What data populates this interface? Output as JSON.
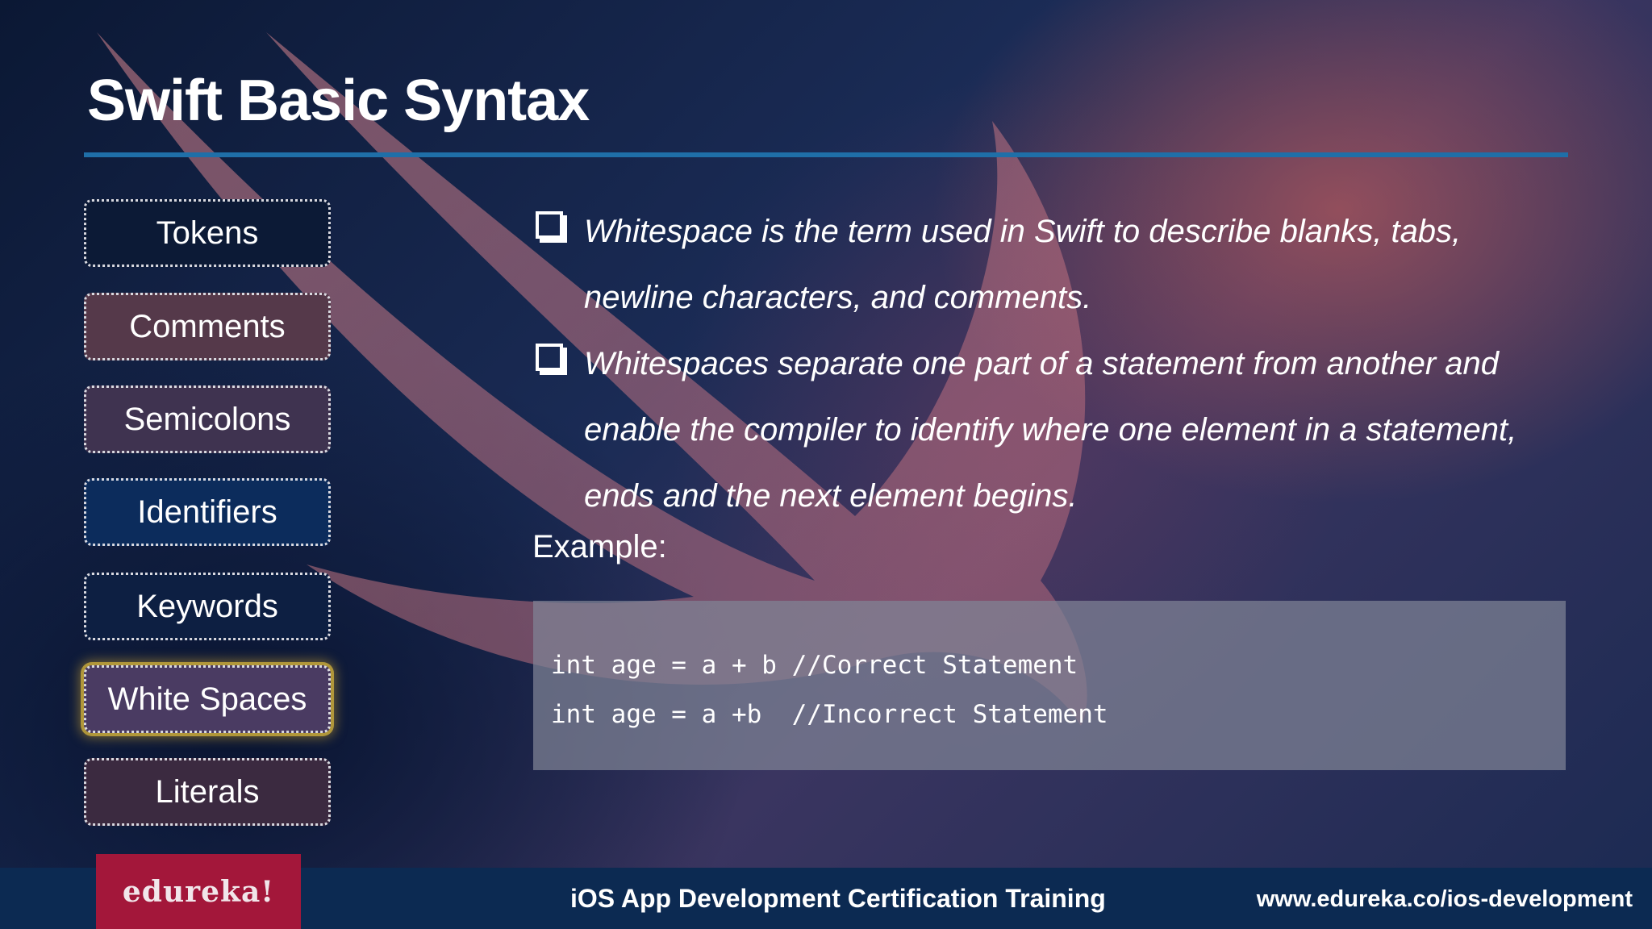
{
  "slide": {
    "title": "Swift Basic Syntax"
  },
  "sidebar": {
    "items": [
      {
        "label": "Tokens",
        "bg": "#0c1a36",
        "active": false
      },
      {
        "label": "Comments",
        "bg": "#55394a",
        "active": false
      },
      {
        "label": "Semicolons",
        "bg": "#3f3350",
        "active": false
      },
      {
        "label": "Identifiers",
        "bg": "#0c2c5c",
        "active": false
      },
      {
        "label": "Keywords",
        "bg": "#0d1f42",
        "active": false
      },
      {
        "label": "White Spaces",
        "bg": "#4a3b62",
        "active": true
      },
      {
        "label": "Literals",
        "bg": "#3b2a40",
        "active": false
      }
    ]
  },
  "content": {
    "bullets": [
      {
        "icon": "checkbox-icon",
        "lines": [
          "Whitespace is the term used in Swift to describe blanks, tabs,",
          "newline characters, and comments."
        ]
      },
      {
        "icon": "checkbox-icon",
        "lines": [
          "Whitespaces separate one part of a statement from another and",
          "enable the compiler to identify where one element in a statement,",
          "ends and the next element begins."
        ]
      }
    ],
    "example_label": "Example:",
    "code": [
      "int age = a + b //Correct Statement",
      "int age = a +b  //Incorrect Statement"
    ]
  },
  "footer": {
    "logo_text": "edureka!",
    "course_title": "iOS App Development Certification Training",
    "url": "www.edureka.co/ios-development"
  },
  "colors": {
    "accent_rule": "#1f6fa8",
    "logo_bg": "#a3173a",
    "footer_bg": "#0c2a52",
    "active_glow": "#c8a03c"
  }
}
